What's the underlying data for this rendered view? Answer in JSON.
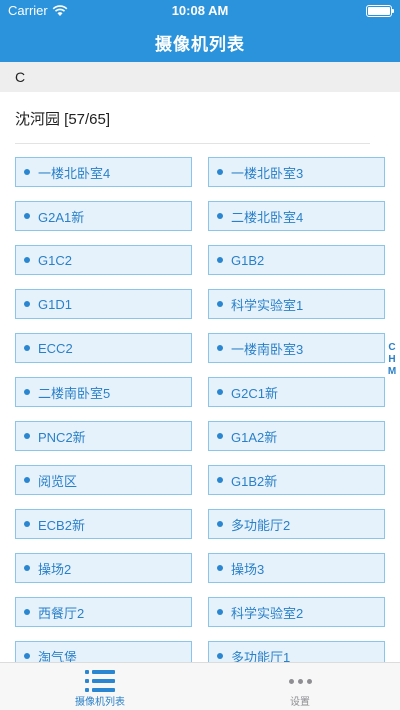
{
  "status": {
    "carrier": "Carrier",
    "time": "10:08 AM"
  },
  "nav": {
    "title": "摄像机列表"
  },
  "section": {
    "letter": "C"
  },
  "group": {
    "title": "沈河园 [57/65]"
  },
  "cameras": [
    "一楼北卧室4",
    "一楼北卧室3",
    "G2A1新",
    "二楼北卧室4",
    "G1C2",
    "G1B2",
    "G1D1",
    "科学实验室1",
    "ECC2",
    "一楼南卧室3",
    "二楼南卧室5",
    "G2C1新",
    "PNC2新",
    "G1A2新",
    "阅览区",
    "G1B2新",
    "ECB2新",
    "多功能厅2",
    "操场2",
    "操场3",
    "西餐厅2",
    "科学实验室2",
    "淘气堡",
    "多功能厅1"
  ],
  "index": [
    "C",
    "H",
    "M"
  ],
  "tabs": [
    {
      "label": "摄像机列表",
      "icon": "list-icon",
      "active": true
    },
    {
      "label": "设置",
      "icon": "more-icon",
      "active": false
    }
  ],
  "colors": {
    "header": "#2a93dc",
    "accent": "#2a80c8",
    "item_bg": "#e6f2fb",
    "item_border": "#8cc4ea"
  }
}
